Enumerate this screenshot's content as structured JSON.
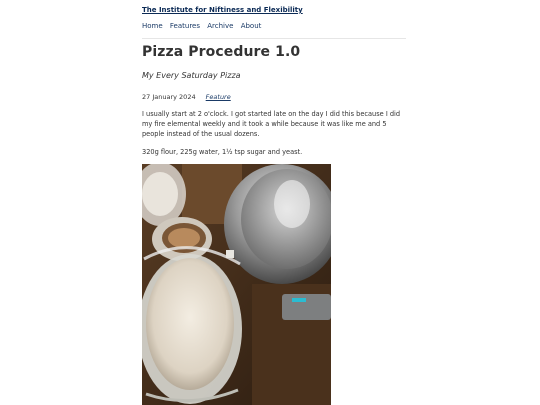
{
  "site": {
    "title": "The Institute for Niftiness and Flexibility"
  },
  "nav": {
    "items": [
      {
        "label": "Home"
      },
      {
        "label": "Features"
      },
      {
        "label": "Archive"
      },
      {
        "label": "About"
      }
    ]
  },
  "post": {
    "title": "Pizza Procedure 1.0",
    "subtitle": "My Every Saturday Pizza",
    "date": "27 January 2024",
    "category": "Feature",
    "paragraphs": [
      "I usually start at 2 o'clock. I got started late on the day I did this because I did my fire elemental weekly and it took a while because it was like me and 5 people instead of the usual dozens.",
      "320g flour, 225g water, 1½ tsp sugar and yeast."
    ]
  },
  "colors": {
    "link": "#1a3a66",
    "site_title": "#0b2a55"
  }
}
